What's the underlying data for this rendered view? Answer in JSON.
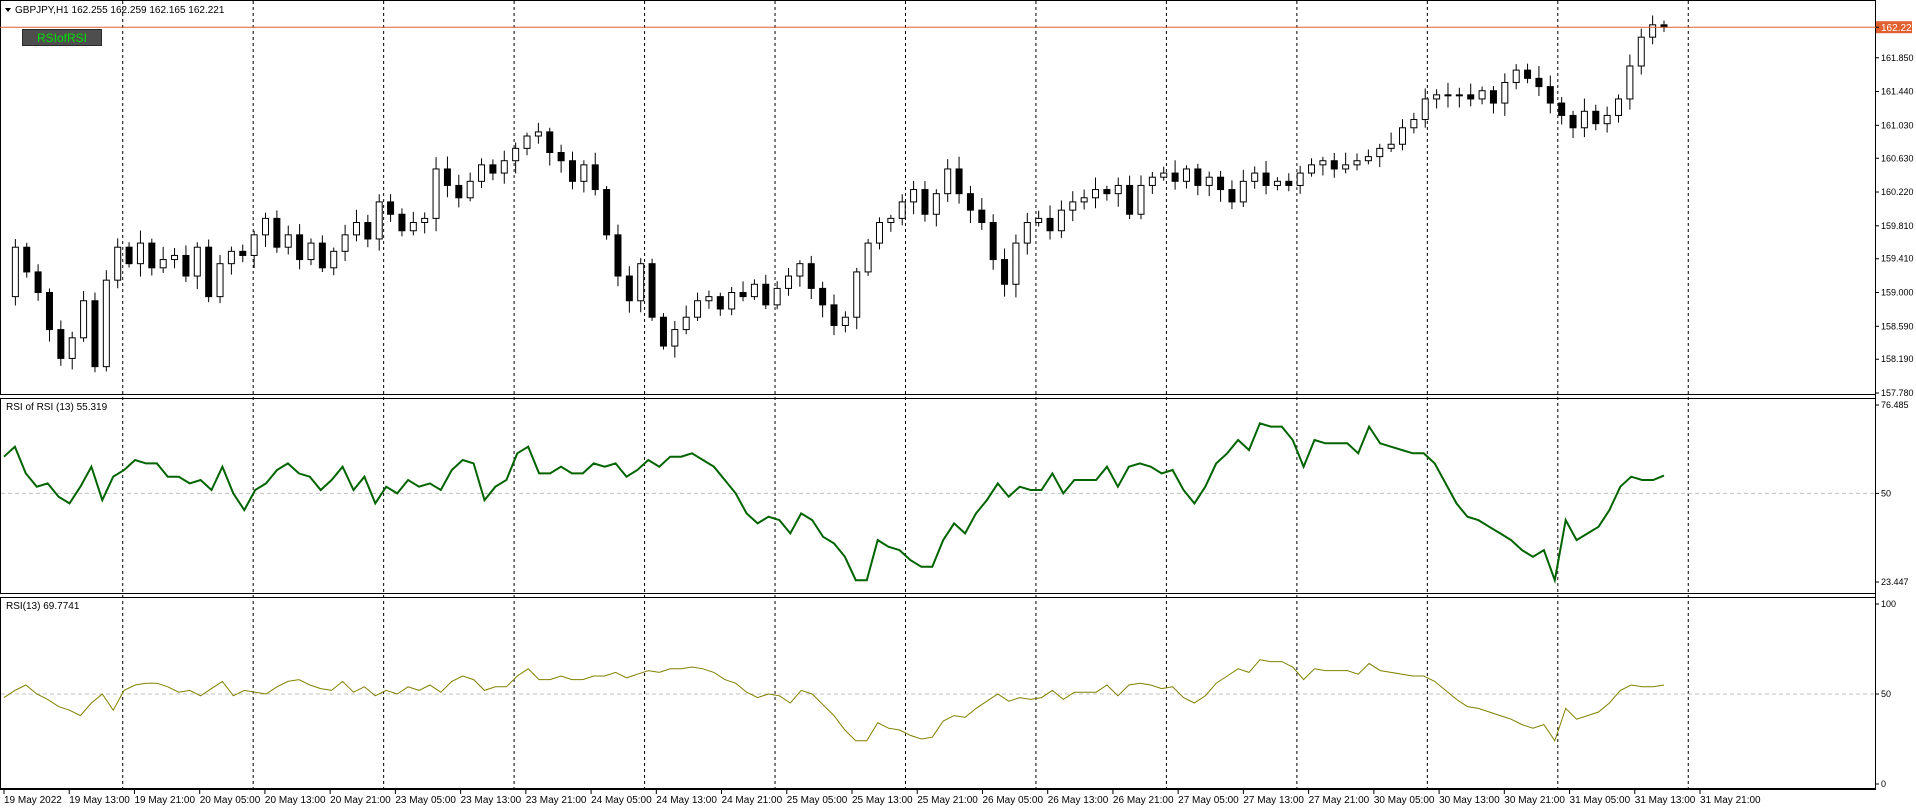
{
  "window": {
    "symbol_header": "GBPJPY,H1  162.255 162.259 162.165 162.221",
    "indicator_button": "RSIofRSI",
    "current_price_label": "162.221"
  },
  "panels": {
    "rsi_of_rsi_title": "RSI of RSI (13) 55.319",
    "rsi_title": "RSI(13) 69.7741"
  },
  "colors": {
    "bull_candle": "#ffffff",
    "bear_candle": "#000000",
    "price_line": "#e06030",
    "rsi_of_rsi_line": "#006400",
    "rsi_line": "#808000",
    "grid": "#000000",
    "level_line": "#c0c0c0"
  },
  "chart_data": [
    {
      "type": "candlestick",
      "symbol": "GBPJPY",
      "timeframe": "H1",
      "y_ticks": [
        "162.221",
        "161.850",
        "161.440",
        "161.030",
        "160.630",
        "160.220",
        "159.810",
        "159.410",
        "159.000",
        "158.590",
        "158.190",
        "157.780"
      ],
      "ylim": [
        157.78,
        162.26
      ],
      "x_ticks": [
        "19 May 2022",
        "19 May 13:00",
        "19 May 21:00",
        "20 May 05:00",
        "20 May 13:00",
        "20 May 21:00",
        "23 May 05:00",
        "23 May 13:00",
        "23 May 21:00",
        "24 May 05:00",
        "24 May 13:00",
        "24 May 21:00",
        "25 May 05:00",
        "25 May 13:00",
        "25 May 21:00",
        "26 May 05:00",
        "26 May 13:00",
        "26 May 21:00",
        "27 May 05:00",
        "27 May 13:00",
        "27 May 21:00",
        "30 May 05:00",
        "30 May 13:00",
        "30 May 21:00",
        "31 May 05:00",
        "31 May 13:00",
        "31 May 21:00"
      ],
      "close_path": [
        158.95,
        159.55,
        159.25,
        159.0,
        158.55,
        158.2,
        158.45,
        158.9,
        158.1,
        159.15,
        159.55,
        159.35,
        159.6,
        159.3,
        159.4,
        159.45,
        159.2,
        159.55,
        158.95,
        159.35,
        159.5,
        159.45,
        159.7,
        159.9,
        159.55,
        159.7,
        159.4,
        159.6,
        159.3,
        159.5,
        159.7,
        159.85,
        159.65,
        160.1,
        159.95,
        159.75,
        159.85,
        159.9,
        160.5,
        160.3,
        160.15,
        160.35,
        160.55,
        160.45,
        160.6,
        160.75,
        160.9,
        160.95,
        160.7,
        160.6,
        160.35,
        160.55,
        160.25,
        159.7,
        159.2,
        158.9,
        159.35,
        158.7,
        158.35,
        158.55,
        158.7,
        158.9,
        158.95,
        158.8,
        159.0,
        158.95,
        159.1,
        158.85,
        159.05,
        159.2,
        159.35,
        159.05,
        158.85,
        158.6,
        158.7,
        159.25,
        159.6,
        159.85,
        159.9,
        160.1,
        160.25,
        159.95,
        160.2,
        160.5,
        160.2,
        160.0,
        159.85,
        159.4,
        159.1,
        159.6,
        159.85,
        159.9,
        159.75,
        160.0,
        160.1,
        160.15,
        160.25,
        160.2,
        160.3,
        159.95,
        160.3,
        160.4,
        160.45,
        160.35,
        160.5,
        160.3,
        160.4,
        160.25,
        160.1,
        160.35,
        160.45,
        160.3,
        160.35,
        160.3,
        160.45,
        160.55,
        160.6,
        160.5,
        160.55,
        160.6,
        160.65,
        160.75,
        160.8,
        161.0,
        161.1,
        161.35,
        161.4,
        161.4,
        161.4,
        161.35,
        161.45,
        161.3,
        161.55,
        161.7,
        161.6,
        161.5,
        161.3,
        161.15,
        161.0,
        161.2,
        161.05,
        161.15,
        161.35,
        161.75,
        162.1,
        162.25,
        162.221
      ]
    },
    {
      "type": "line",
      "name": "RSI of RSI (13)",
      "last_value": 55.319,
      "ylim": [
        23.447,
        76.485
      ],
      "y_ticks": [
        "76.485",
        "50",
        "23.447"
      ],
      "level": 50,
      "values": [
        61,
        64,
        56,
        52,
        53,
        49,
        47,
        52,
        58,
        48,
        55,
        57,
        60,
        59,
        59,
        55,
        55,
        53,
        54,
        51,
        58,
        50,
        45,
        51,
        53,
        57,
        59,
        56,
        55,
        51,
        54,
        58,
        51,
        55,
        47,
        52,
        50,
        54,
        52,
        53,
        51,
        57,
        60,
        59,
        48,
        52,
        54,
        62,
        64,
        56,
        56,
        58,
        56,
        56,
        59,
        58,
        59,
        55,
        57,
        60,
        58,
        61,
        61,
        62,
        60,
        58,
        54,
        50,
        44,
        41,
        43,
        42,
        38,
        44,
        42,
        37,
        35,
        31,
        24,
        24,
        36,
        34,
        33,
        30,
        28,
        28,
        36,
        41,
        38,
        44,
        48,
        53,
        49,
        52,
        51,
        51,
        56,
        50,
        54,
        54,
        54,
        58,
        52,
        58,
        59,
        58,
        56,
        57,
        51,
        47,
        52,
        59,
        62,
        66,
        63,
        71,
        70,
        70,
        66,
        58,
        66,
        65,
        65,
        65,
        62,
        70,
        65,
        64,
        63,
        62,
        62,
        59,
        53,
        47,
        43,
        42,
        40,
        38,
        36,
        33,
        31,
        33,
        24,
        42,
        36,
        38,
        40,
        45,
        52,
        55,
        54,
        54,
        55.319
      ]
    },
    {
      "type": "line",
      "name": "RSI(13)",
      "last_value": 69.7741,
      "ylim": [
        0,
        100
      ],
      "y_ticks": [
        "100",
        "50",
        "0"
      ],
      "level": 50,
      "values": [
        48,
        52,
        55,
        50,
        47,
        43,
        41,
        38,
        45,
        50,
        41,
        52,
        55,
        56,
        56,
        54,
        51,
        52,
        49,
        53,
        57,
        49,
        52,
        51,
        50,
        54,
        57,
        58,
        55,
        53,
        52,
        57,
        51,
        54,
        49,
        52,
        50,
        54,
        52,
        55,
        51,
        57,
        60,
        58,
        52,
        54,
        54,
        60,
        64,
        58,
        58,
        60,
        58,
        58,
        60,
        60,
        62,
        59,
        61,
        63,
        62,
        64,
        64,
        65,
        64,
        62,
        58,
        56,
        51,
        48,
        50,
        49,
        45,
        52,
        50,
        44,
        38,
        30,
        24,
        24,
        34,
        31,
        30,
        27,
        25,
        26,
        35,
        38,
        37,
        42,
        46,
        50,
        46,
        48,
        47,
        48,
        52,
        47,
        51,
        51,
        51,
        55,
        49,
        55,
        56,
        55,
        53,
        54,
        48,
        45,
        49,
        56,
        60,
        64,
        62,
        69,
        68,
        68,
        65,
        58,
        64,
        63,
        63,
        63,
        61,
        67,
        63,
        62,
        61,
        60,
        60,
        57,
        52,
        47,
        43,
        42,
        40,
        38,
        36,
        33,
        31,
        33,
        24,
        42,
        36,
        38,
        40,
        45,
        52,
        55,
        54,
        54,
        55
      ]
    }
  ]
}
